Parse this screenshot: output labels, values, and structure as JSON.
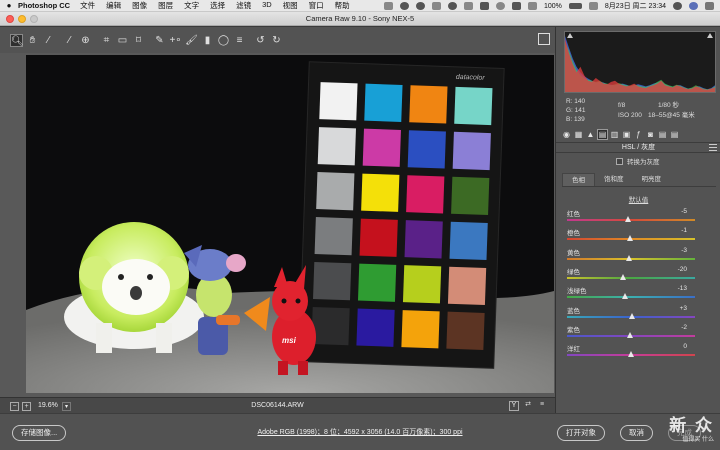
{
  "menubar": {
    "app_name": "Photoshop CC",
    "items": [
      "文件",
      "编辑",
      "图像",
      "图层",
      "文字",
      "选择",
      "滤镜",
      "3D",
      "视图",
      "窗口",
      "帮助"
    ],
    "battery": "100%",
    "datetime": "8月23日 周二 23:34"
  },
  "window": {
    "title": "Camera Raw 9.10  -  Sony NEX-5"
  },
  "toolbar": {
    "tools": [
      {
        "name": "zoom-tool",
        "icon": "magnifier-icon",
        "glyph": "🔍︎",
        "active": true
      },
      {
        "name": "hand-tool",
        "icon": "hand-icon",
        "glyph": "✋︎"
      },
      {
        "name": "white-balance-tool",
        "icon": "eyedropper-icon",
        "glyph": "⁄"
      },
      {
        "name": "color-sampler-tool",
        "icon": "color-sampler-icon",
        "glyph": "⁄"
      },
      {
        "name": "targeted-adjustment-tool",
        "icon": "target-adjust-icon",
        "glyph": "⊕"
      },
      {
        "name": "crop-tool",
        "icon": "crop-icon",
        "glyph": "⌗"
      },
      {
        "name": "straighten-tool",
        "icon": "straighten-icon",
        "glyph": "▭"
      },
      {
        "name": "transform-tool",
        "icon": "transform-icon",
        "glyph": "⌑"
      },
      {
        "name": "spot-removal-tool",
        "icon": "spot-removal-icon",
        "glyph": "✎"
      },
      {
        "name": "red-eye-tool",
        "icon": "red-eye-icon",
        "glyph": "+∘"
      },
      {
        "name": "adjustment-brush-tool",
        "icon": "brush-icon",
        "glyph": "🖌︎"
      },
      {
        "name": "graduated-filter-tool",
        "icon": "graduated-filter-icon",
        "glyph": "▮"
      },
      {
        "name": "radial-filter-tool",
        "icon": "radial-filter-icon",
        "glyph": "◯"
      },
      {
        "name": "preferences-tool",
        "icon": "list-icon",
        "glyph": "≡"
      },
      {
        "name": "rotate-left-tool",
        "icon": "rotate-left-icon",
        "glyph": "↺"
      },
      {
        "name": "rotate-right-tool",
        "icon": "rotate-right-icon",
        "glyph": "↻"
      }
    ]
  },
  "status": {
    "zoom": "19.6%",
    "filename": "DSC06144.ARW",
    "minus": "−",
    "plus": "+",
    "y_toggle": "Y",
    "zoom_arrow": "▾"
  },
  "bottom": {
    "save_label": "存储图像...",
    "workflow": "Adobe RGB (1998)；8 位；4592 x 3056 (14.0 百万像素)；300 ppi",
    "open_label": "打开对象",
    "cancel_label": "取消",
    "done_label": "完成",
    "watermark_big": "新 众",
    "watermark_small": "值得买 什么"
  },
  "readout": {
    "r": "R:  140",
    "g": "G:  141",
    "b": "B:  139"
  },
  "camera_info": {
    "aperture": "f/8",
    "shutter": "1/80 秒",
    "iso": "ISO 200",
    "lens": "18–55@45 毫米"
  },
  "panel": {
    "section_title": "HSL / 灰度",
    "grayscale_label": "转换为灰度",
    "subtabs": [
      "色相",
      "饱和度",
      "明亮度"
    ],
    "defaults_label": "默认值",
    "tab_icons": [
      "basic-icon",
      "tone-curve-icon",
      "detail-icon",
      "hsl-icon",
      "split-tone-icon",
      "lens-icon",
      "fx-icon",
      "camera-calibration-icon",
      "presets-icon",
      "snapshots-icon"
    ]
  },
  "sliders": [
    {
      "label": "红色",
      "value": "-5",
      "norm": 0.48,
      "gradient": [
        "#c0398e",
        "#d64a3a",
        "#d08a27"
      ]
    },
    {
      "label": "橙色",
      "value": "-1",
      "norm": 0.495,
      "gradient": [
        "#d34632",
        "#e08a25",
        "#d6c22a"
      ]
    },
    {
      "label": "黄色",
      "value": "-3",
      "norm": 0.49,
      "gradient": [
        "#d2782b",
        "#d9c22b",
        "#63b23b"
      ]
    },
    {
      "label": "绿色",
      "value": "-20",
      "norm": 0.44,
      "gradient": [
        "#c9c32b",
        "#4aa743",
        "#3aa8a0"
      ]
    },
    {
      "label": "浅绿色",
      "value": "-13",
      "norm": 0.46,
      "gradient": [
        "#45a947",
        "#3bb0b0",
        "#3a6ec8"
      ]
    },
    {
      "label": "蓝色",
      "value": "+3",
      "norm": 0.51,
      "gradient": [
        "#37a9b8",
        "#3b62cd",
        "#8446c0"
      ]
    },
    {
      "label": "紫色",
      "value": "-2",
      "norm": 0.495,
      "gradient": [
        "#4a59cb",
        "#8446c0",
        "#c23c9d"
      ]
    },
    {
      "label": "洋红",
      "value": "0",
      "norm": 0.5,
      "gradient": [
        "#8247c2",
        "#c63c98",
        "#d1444d"
      ]
    }
  ],
  "histogram": {
    "red": [
      0.95,
      0.7,
      0.5,
      0.35,
      0.45,
      0.3,
      0.2,
      0.18,
      0.25,
      0.2,
      0.15,
      0.14,
      0.18,
      0.2,
      0.15,
      0.12,
      0.1,
      0.12,
      0.15,
      0.1,
      0.08,
      0.07,
      0.1,
      0.12,
      0.15,
      0.2,
      0.12,
      0.1,
      0.08,
      0.12,
      0.1,
      0.07,
      0.05,
      0.06,
      0.1,
      0.08,
      0.05,
      0.04,
      0.06,
      0.08
    ],
    "green": [
      0.9,
      0.75,
      0.55,
      0.4,
      0.3,
      0.25,
      0.22,
      0.2,
      0.18,
      0.2,
      0.16,
      0.15,
      0.12,
      0.14,
      0.16,
      0.14,
      0.12,
      0.11,
      0.13,
      0.12,
      0.1,
      0.09,
      0.11,
      0.14,
      0.18,
      0.22,
      0.15,
      0.12,
      0.1,
      0.13,
      0.11,
      0.08,
      0.06,
      0.08,
      0.12,
      0.09,
      0.06,
      0.05,
      0.06,
      0.1
    ],
    "blue": [
      1.0,
      0.8,
      0.6,
      0.45,
      0.35,
      0.28,
      0.24,
      0.2,
      0.17,
      0.18,
      0.17,
      0.14,
      0.13,
      0.12,
      0.14,
      0.15,
      0.13,
      0.1,
      0.12,
      0.14,
      0.12,
      0.1,
      0.12,
      0.15,
      0.17,
      0.2,
      0.14,
      0.11,
      0.09,
      0.12,
      0.12,
      0.09,
      0.06,
      0.07,
      0.1,
      0.1,
      0.07,
      0.05,
      0.07,
      0.12
    ]
  },
  "checker": {
    "brand": "datacolor",
    "patches": [
      "#f2f2f2",
      "#18a0d6",
      "#f08512",
      "#76d5c8",
      "#d8d9da",
      "#cc3aa6",
      "#2b4fc1",
      "#8b7fd6",
      "#a9abac",
      "#f4e009",
      "#d91d63",
      "#3c6a24",
      "#7b7d7f",
      "#c5111d",
      "#5a2188",
      "#3b78c0",
      "#4b4c4e",
      "#2f9c32",
      "#b6cf1d",
      "#d38c77",
      "#2b2b2c",
      "#2a1aa0",
      "#f4a30b",
      "#5c3423"
    ]
  }
}
